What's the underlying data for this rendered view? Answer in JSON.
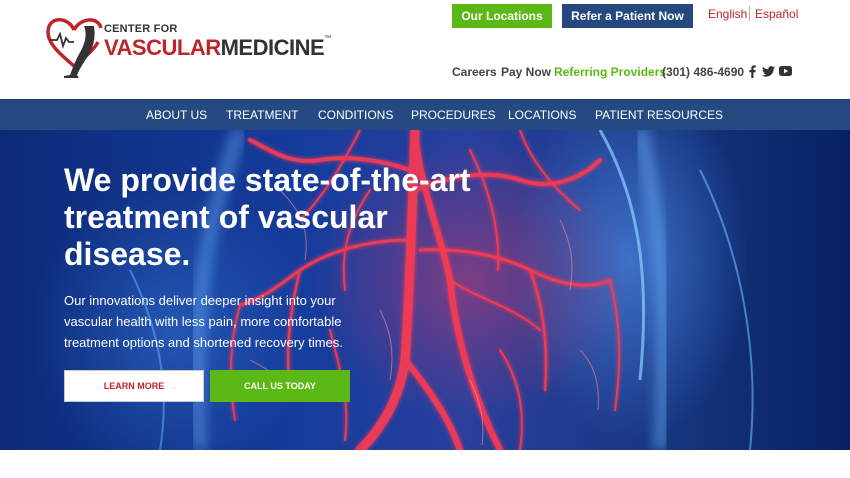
{
  "logo": {
    "line1": "CENTER FOR",
    "line2a": "VASCULAR",
    "line2b": "MEDICINE",
    "trademark": "™"
  },
  "header": {
    "locations_button": "Our Locations",
    "refer_button": "Refer a Patient Now",
    "lang_english": "English",
    "lang_spanish": "Español",
    "careers": "Careers",
    "pay_now": "Pay Now",
    "referring_providers": "Referring Providers",
    "phone": "(301) 486-4690",
    "social_icons": [
      "facebook-icon",
      "twitter-icon",
      "youtube-icon"
    ]
  },
  "nav": {
    "items": [
      "ABOUT US",
      "TREATMENT",
      "CONDITIONS",
      "PROCEDURES",
      "LOCATIONS",
      "PATIENT RESOURCES"
    ]
  },
  "hero": {
    "title": "We provide state-of-the-art treatment of vascular disease.",
    "subtitle": "Our innovations deliver deeper insight into your vascular health with less pain, more comfortable treatment options and shortened recovery times.",
    "learn_more": "LEARN MORE",
    "call_us": "CALL US TODAY"
  },
  "colors": {
    "brand_red": "#c0242b",
    "brand_green": "#5cb814",
    "brand_navy": "#24487f"
  }
}
